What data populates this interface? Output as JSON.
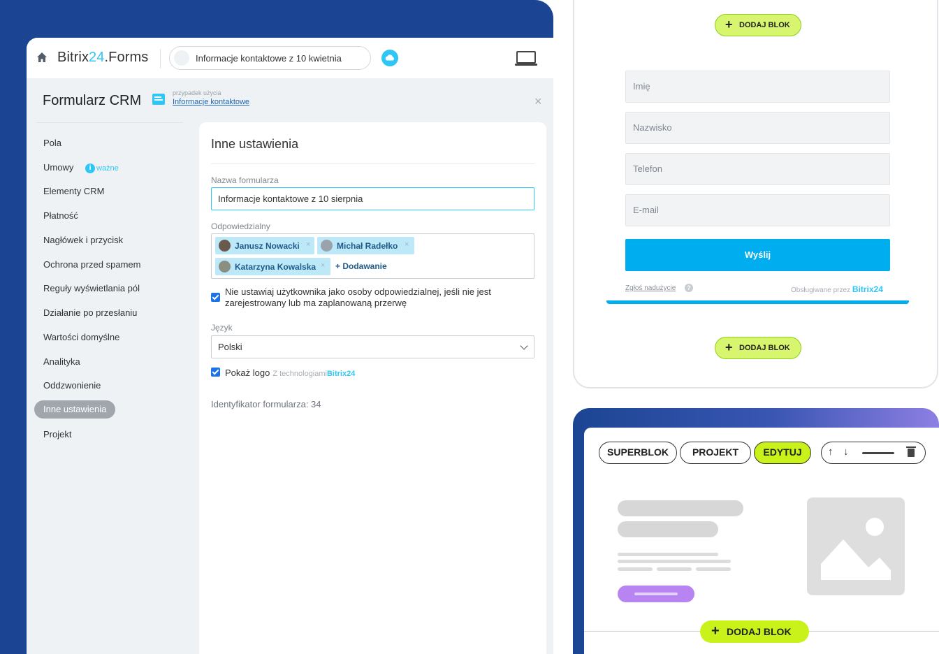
{
  "app": {
    "brand_prefix": "Bitrix",
    "brand_number": "24",
    "brand_suffix": ".Forms",
    "current_form": "Informacje kontaktowe z 10 kwietnia"
  },
  "header": {
    "title": "Formularz CRM",
    "usecase_label": "przypadek użycia",
    "usecase_link": "Informacje kontaktowe"
  },
  "sidebar": {
    "items": [
      {
        "label": "Pola"
      },
      {
        "label": "Umowy"
      },
      {
        "label": "Elementy CRM"
      },
      {
        "label": "Płatność"
      },
      {
        "label": "Nagłówek i przycisk"
      },
      {
        "label": "Ochrona przed spamem"
      },
      {
        "label": "Reguły wyświetlania pól"
      },
      {
        "label": "Działanie po przesłaniu"
      },
      {
        "label": "Wartości domyślne"
      },
      {
        "label": "Analityka"
      },
      {
        "label": "Oddzwonienie"
      },
      {
        "label": "Inne ustawienia"
      },
      {
        "label": "Projekt"
      }
    ],
    "active_index": 11,
    "badge_label": "ważne"
  },
  "settings": {
    "title": "Inne ustawienia",
    "form_name_label": "Nazwa formularza",
    "form_name_value": "Informacje kontaktowe z 10 sierpnia",
    "responsible_label": "Odpowiedzialny",
    "users": [
      "Janusz Nowacki",
      "Michał Radełko",
      "Katarzyna Kowalska"
    ],
    "add_user_label": "+ Dodawanie",
    "checkbox_not_assign": "Nie ustawiaj użytkownika jako osoby odpowiedzialnej, jeśli nie jest zarejestrowany lub ma zaplanowaną przerwę",
    "language_label": "Język",
    "language_value": "Polski",
    "show_logo_label": "Pokaż logo",
    "tech_label": "Z technologiami",
    "tech_brand": "Bitrix24",
    "form_id_text": "Identyfikator formularza: 34"
  },
  "preview": {
    "add_block_label": "DODAJ BLOK",
    "fields": [
      "Imię",
      "Nazwisko",
      "Telefon",
      "E-mail"
    ],
    "submit_label": "Wyślij",
    "report_link": "Zgłoś nadużycie",
    "powered_by": "Obsługiwane przez",
    "powered_brand_prefix": "Bitrix",
    "powered_brand_number": "24"
  },
  "editor": {
    "buttons": [
      "SUPERBLOK",
      "PROJEKT",
      "EDYTUJ"
    ],
    "add_block_label": "DODAJ BLOK"
  },
  "colors": {
    "accent": "#2fc6f6",
    "brand_blue": "#1b4593",
    "lime": "#c9f21a",
    "submit_blue": "#00aeef"
  }
}
